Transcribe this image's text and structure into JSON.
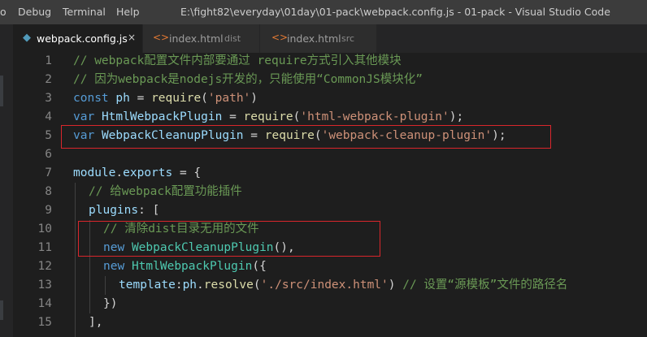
{
  "menu": {
    "items": [
      "o",
      "Debug",
      "Terminal",
      "Help"
    ]
  },
  "window": {
    "title": "E:\\fight82\\everyday\\01day\\01-pack\\webpack.config.js - 01-pack - Visual Studio Code"
  },
  "tabs": [
    {
      "label": "webpack.config.js",
      "desc": "",
      "icon": "js-file-icon",
      "close": "×",
      "active": true
    },
    {
      "label": "index.html",
      "desc": "dist",
      "icon": "html-file-icon",
      "icon_glyph": "<>",
      "active": false
    },
    {
      "label": "index.html",
      "desc": "src",
      "icon": "html-file-icon",
      "icon_glyph": "<>",
      "active": false
    }
  ],
  "js_icon_glyph": "◆",
  "line_numbers": [
    "1",
    "2",
    "3",
    "4",
    "5",
    "6",
    "7",
    "8",
    "9",
    "10",
    "11",
    "12",
    "13",
    "14",
    "15"
  ],
  "code": {
    "l1": {
      "c": "// webpack配置文件内部要通过 require方式引入其他模块"
    },
    "l2": {
      "c": "// 因为webpack是nodejs开发的，只能使用“CommonJS模块化”"
    },
    "l3": {
      "kw": "const",
      "sp": " ",
      "var": "ph",
      "eq": " = ",
      "fn": "require",
      "p1": "(",
      "str": "'path'",
      "p2": ")"
    },
    "l4": {
      "kw": "var",
      "sp": " ",
      "cls": "HtmlWebpackPlugin",
      "eq": " = ",
      "fn": "require",
      "p1": "(",
      "str": "'html-webpack-plugin'",
      "p2": ");"
    },
    "l5": {
      "kw": "var",
      "sp": " ",
      "cls": "WebpackCleanupPlugin",
      "eq": " = ",
      "fn": "require",
      "p1": "(",
      "str": "'webpack-cleanup-plugin'",
      "p2": ");"
    },
    "l7": {
      "var1": "module",
      "dot": ".",
      "var2": "exports",
      "rest": " = {"
    },
    "l8": {
      "c": "// 给webpack配置功能插件"
    },
    "l9": {
      "var": "plugins",
      "rest": ": ["
    },
    "l10": {
      "c": "// 清除dist目录无用的文件"
    },
    "l11": {
      "kw": "new",
      "sp": " ",
      "cls": "WebpackCleanupPlugin",
      "rest": "(),"
    },
    "l12": {
      "kw": "new",
      "sp": " ",
      "cls": "HtmlWebpackPlugin",
      "rest": "({"
    },
    "l13": {
      "var": "template",
      "colon": ":",
      "var2": "ph",
      "dot": ".",
      "fn": "resolve",
      "p1": "(",
      "str": "'./src/index.html'",
      "p2": ") ",
      "c": "// 设置“源模板”文件的路径名"
    },
    "l14": {
      "rest": "})"
    },
    "l15": {
      "rest": "],"
    }
  }
}
